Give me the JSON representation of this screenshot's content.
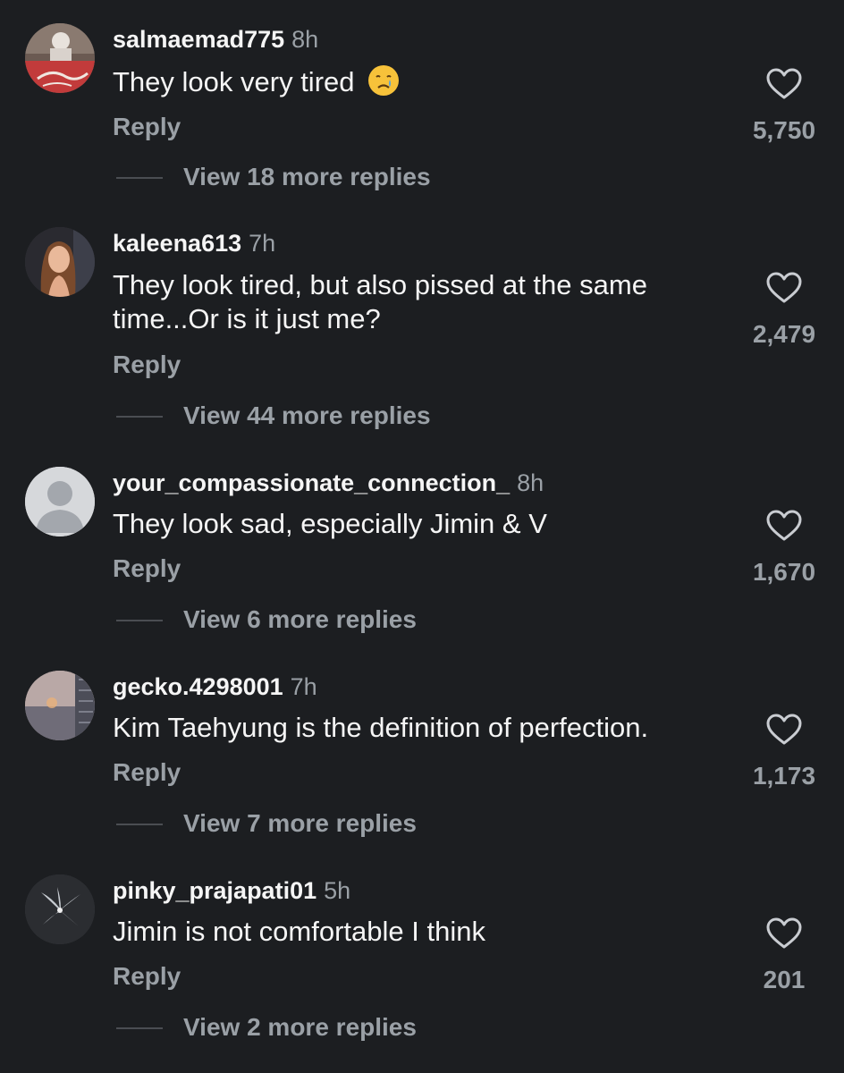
{
  "comments": [
    {
      "username": "salmaemad775",
      "time": "8h",
      "text": "They look very tired",
      "emoji": "crying-face-emoji",
      "reply_label": "Reply",
      "view_replies": "View 18 more replies",
      "likes": "5,750"
    },
    {
      "username": "kaleena613",
      "time": "7h",
      "text": "They look tired, but also pissed at the same time...Or is it just me?",
      "reply_label": "Reply",
      "view_replies": "View 44 more replies",
      "likes": "2,479"
    },
    {
      "username": "your_compassionate_connection_",
      "time": "8h",
      "text": "They look sad, especially Jimin & V",
      "reply_label": "Reply",
      "view_replies": "View 6 more replies",
      "likes": "1,670"
    },
    {
      "username": "gecko.4298001",
      "time": "7h",
      "text": "Kim Taehyung is the definition of perfection.",
      "reply_label": "Reply",
      "view_replies": "View 7 more replies",
      "likes": "1,173"
    },
    {
      "username": "pinky_prajapati01",
      "time": "5h",
      "text": "Jimin is not comfortable I think",
      "reply_label": "Reply",
      "view_replies": "View 2 more replies",
      "likes": "201"
    }
  ],
  "colors": {
    "background": "#1c1e21",
    "primary_text": "#f5f5f5",
    "secondary_text": "#9aa0a6"
  }
}
